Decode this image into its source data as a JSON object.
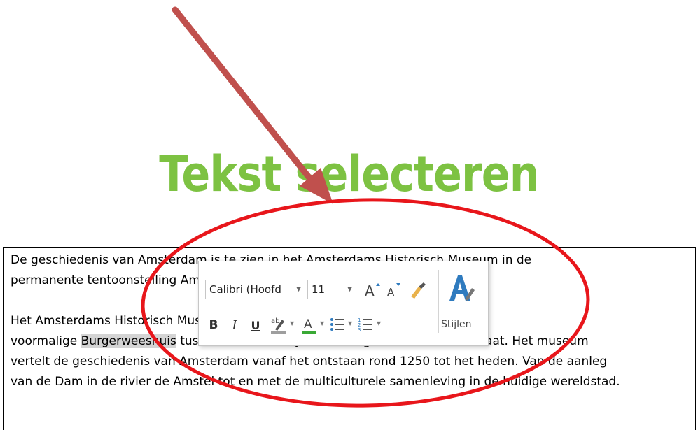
{
  "title": "Tekst selecteren",
  "document": {
    "line1": "De geschiedenis van Amsterdam is te zien in het Amsterdams Historisch Museum in de",
    "line2": "permanente tentoonstelling Amsterdam DNA.",
    "line3": "Het Amsterdams Historisch Museum is sinds 1975 gevestigd in het",
    "line4_before": "voormalige ",
    "line4_highlight": "Burgerweeshuis",
    "line4_after": " tussen de Nieuwezijds Voorburgwal en de Kalverstraat. Het museum",
    "line5": "vertelt de geschiedenis van Amsterdam vanaf het ontstaan rond 1250 tot het heden. Van de aanleg",
    "line6": "van de Dam in de rivier de Amstel tot en met de multiculturele samenleving in de huidige wereldstad."
  },
  "mini_toolbar": {
    "font_name": "Calibri (Hoofd",
    "font_size": "11",
    "bold": "B",
    "italic": "I",
    "underline": "U",
    "styles_label": "Stijlen",
    "icons": [
      "grow-font-icon",
      "shrink-font-icon",
      "format-painter-icon",
      "styles-icon",
      "highlight-color-icon",
      "font-color-icon",
      "bullets-icon",
      "numbering-icon"
    ],
    "colors": {
      "highlight": "#9e9e9e",
      "font_color": "#3aa935",
      "styles_icon": "#2f7bbf"
    }
  },
  "annotations": {
    "arrow_color": "#c0504d",
    "ellipse_color": "#e8161b"
  },
  "colors": {
    "title": "#7dc242",
    "selection_highlight": "#d4d4d4"
  }
}
